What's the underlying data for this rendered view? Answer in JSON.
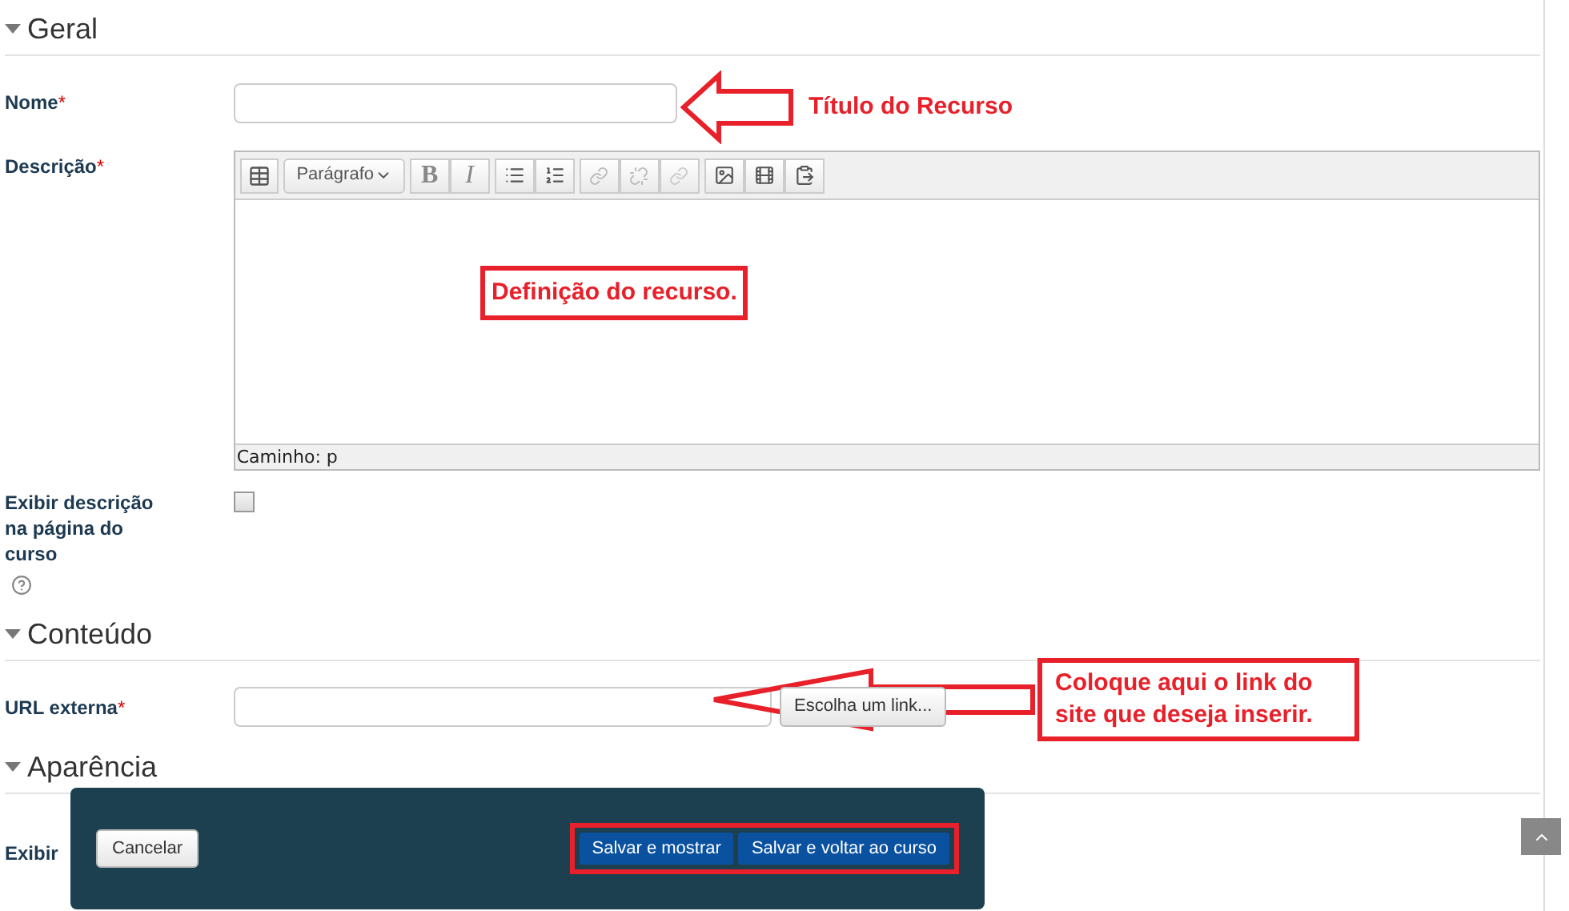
{
  "sections": [
    {
      "title": "Geral",
      "expanded": true
    },
    {
      "title": "Conteúdo",
      "expanded": true
    },
    {
      "title": "Aparência",
      "expanded": true
    }
  ],
  "fields": {
    "name": {
      "label": "Nome",
      "required": "*"
    },
    "description": {
      "label": "Descrição",
      "required": "*",
      "format": "Parágrafo",
      "bold": "B",
      "italic": "I",
      "path": "Caminho: p"
    },
    "show_description": {
      "label": "Exibir descrição na página do curso",
      "checked": false
    },
    "url": {
      "label": "URL externa",
      "required": "*",
      "button": "Escolha um link..."
    },
    "display": {
      "label": "Exibir"
    }
  },
  "annotations": [
    {
      "kind": "arrow",
      "text": "Título do Recurso"
    },
    {
      "kind": "box",
      "text": "Definição do recurso."
    },
    {
      "kind": "arrow-box",
      "text": "Coloque aqui o link do site que deseja inserir."
    },
    {
      "kind": "frame"
    }
  ],
  "footer": {
    "cancel": "Cancelar",
    "buttons": [
      "Salvar e mostrar",
      "Salvar e voltar ao curso"
    ]
  }
}
